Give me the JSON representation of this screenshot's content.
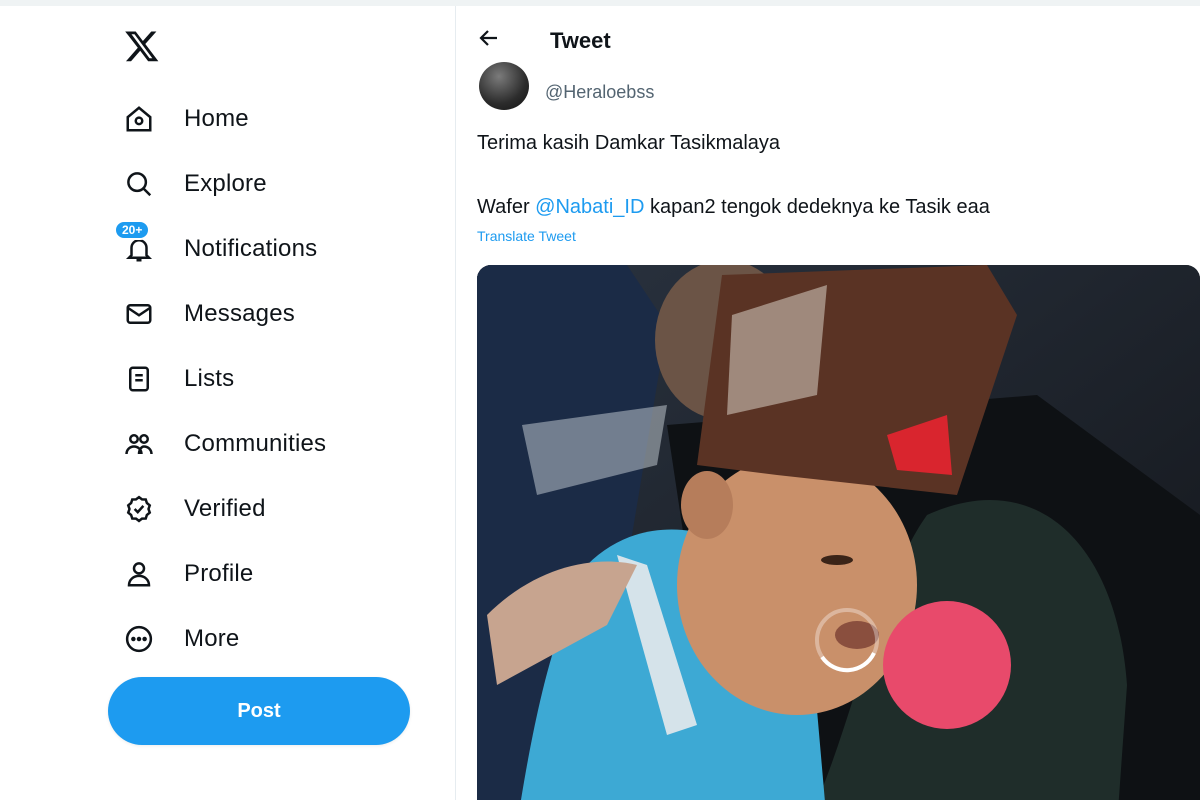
{
  "sidebar": {
    "logo": "x-logo",
    "items": [
      {
        "label": "Home",
        "icon": "home-icon"
      },
      {
        "label": "Explore",
        "icon": "search-icon"
      },
      {
        "label": "Notifications",
        "icon": "bell-icon",
        "badge": "20+"
      },
      {
        "label": "Messages",
        "icon": "envelope-icon"
      },
      {
        "label": "Lists",
        "icon": "list-icon"
      },
      {
        "label": "Communities",
        "icon": "people-icon"
      },
      {
        "label": "Verified",
        "icon": "verified-icon"
      },
      {
        "label": "Profile",
        "icon": "person-icon"
      },
      {
        "label": "More",
        "icon": "more-icon"
      }
    ],
    "post_label": "Post"
  },
  "header": {
    "title": "Tweet"
  },
  "tweet": {
    "handle": "@Heraloebss",
    "line1": "Terima kasih Damkar Tasikmalaya",
    "line2_prefix": "Wafer ",
    "mention": "@Nabati_ID",
    "line2_suffix": " kapan2 tengok dedeknya ke Tasik eaa",
    "translate_label": "Translate Tweet"
  },
  "colors": {
    "accent": "#1d9bf0",
    "text": "#0f1419",
    "secondary": "#536471"
  }
}
